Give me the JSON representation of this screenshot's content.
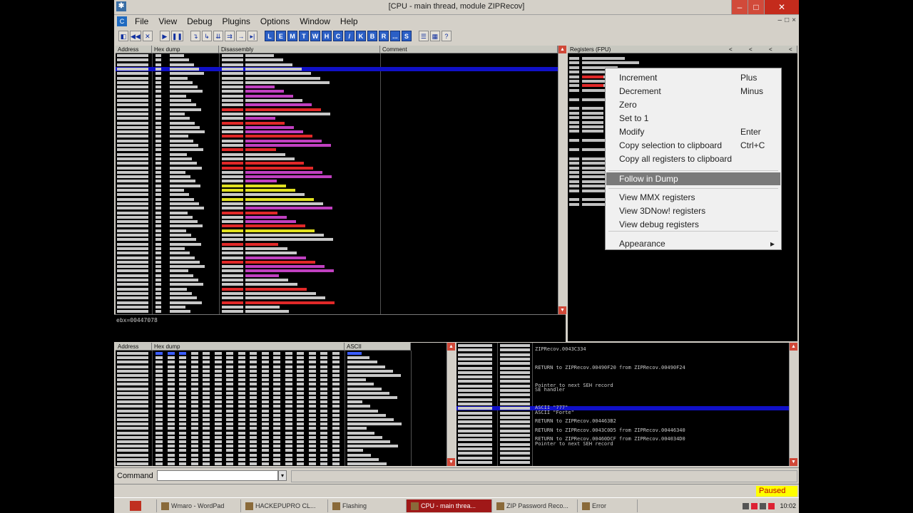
{
  "window": {
    "title": "[CPU - main thread, module ZIPRecov]",
    "controls": {
      "minimize": "–",
      "maximize": "□",
      "close": "✕"
    }
  },
  "menubar": {
    "items": [
      "File",
      "View",
      "Debug",
      "Plugins",
      "Options",
      "Window",
      "Help"
    ],
    "mdi_controls": [
      "–",
      "□",
      "×"
    ]
  },
  "toolbar": {
    "group_a": [
      "◧",
      "◀◀",
      "✕"
    ],
    "group_b": [
      "▶",
      "❚❚"
    ],
    "group_c": [
      "↴",
      "↳",
      "⇊",
      "⇉",
      "→",
      "▸|"
    ],
    "group_d": [
      "L",
      "E",
      "M",
      "T",
      "W",
      "H",
      "C",
      "/",
      "K",
      "B",
      "R",
      "...",
      "S"
    ],
    "group_e": [
      "☰",
      "▦",
      "?"
    ]
  },
  "disasm": {
    "headers": [
      "Address",
      "Hex dump",
      "Disassembly",
      "Comment"
    ],
    "info_line": "ebx=00447078"
  },
  "registers": {
    "header": "Registers (FPU)",
    "nav": [
      "<",
      "<",
      "<",
      "<"
    ]
  },
  "dump": {
    "headers": [
      "Address",
      "Hex dump",
      "ASCII"
    ]
  },
  "stack": {
    "comments": [
      {
        "row": 1,
        "text": "ZIPRecov.0043C334"
      },
      {
        "row": 5,
        "text": "RETURN to ZIPRecov.00490F20 from ZIPRecov.00490F24"
      },
      {
        "row": 9,
        "text": "Pointer to next SEH record"
      },
      {
        "row": 10,
        "text": "SE handler"
      },
      {
        "row": 14,
        "text": "ASCII \"777\""
      },
      {
        "row": 15,
        "text": "ASCII \"Forte\""
      },
      {
        "row": 17,
        "text": "RETURN to ZIPRecov.004463B2"
      },
      {
        "row": 19,
        "text": "RETURN to ZIPRecov.0043C0D5 from ZIPRecov.00446340"
      },
      {
        "row": 21,
        "text": "RETURN to ZIPRecov.00460DCF from ZIPRecov.004034D0"
      },
      {
        "row": 22,
        "text": "Pointer to next SEH record"
      }
    ]
  },
  "context_menu": {
    "items": [
      {
        "label": "Increment",
        "shortcut": "Plus"
      },
      {
        "label": "Decrement",
        "shortcut": "Minus"
      },
      {
        "label": "Zero",
        "shortcut": ""
      },
      {
        "label": "Set to 1",
        "shortcut": ""
      },
      {
        "label": "Modify",
        "shortcut": "Enter"
      },
      {
        "label": "Copy selection to clipboard",
        "shortcut": "Ctrl+C"
      },
      {
        "label": "Copy all registers to clipboard",
        "shortcut": ""
      },
      {
        "label": "Follow in Dump",
        "shortcut": "",
        "selected": true
      },
      {
        "label": "View MMX registers",
        "shortcut": ""
      },
      {
        "label": "View 3DNow! registers",
        "shortcut": ""
      },
      {
        "label": "View debug registers",
        "shortcut": ""
      },
      {
        "label": "Appearance",
        "shortcut": "▸"
      }
    ]
  },
  "command_bar": {
    "label": "Command",
    "dropdown": "▾"
  },
  "status": {
    "state": "Paused"
  },
  "taskbar": {
    "items": [
      {
        "label": "Wmaro - WordPad"
      },
      {
        "label": "HACKEPUPRO CL..."
      },
      {
        "label": "Flashing"
      },
      {
        "label": "CPU - main threa...",
        "active": true
      },
      {
        "label": "ZIP Password Reco..."
      },
      {
        "label": "Error"
      }
    ],
    "clock": "10:02"
  },
  "colors": {
    "app_bg": "#d4d0c8",
    "pane_bg": "#000000",
    "selection_blue": "#1010c8",
    "call_red": "#e02828",
    "jump_yellow": "#e0e020",
    "text_grey": "#c0c0c0",
    "paused_bg": "#ffff00"
  }
}
